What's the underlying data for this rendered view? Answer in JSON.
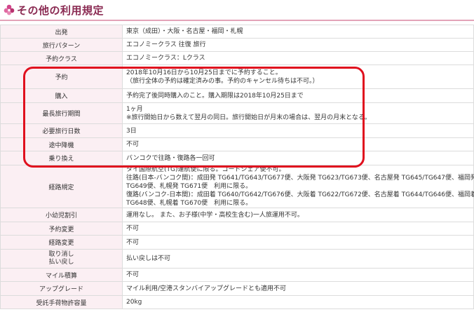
{
  "header": {
    "title": "その他の利用規定"
  },
  "rows": [
    {
      "label": "出発",
      "lines": [
        "東京（成田）・大阪・名古屋・福岡・札幌"
      ]
    },
    {
      "label": "旅行パターン",
      "lines": [
        "エコノミークラス 往復 旅行"
      ]
    },
    {
      "label": "予約クラス",
      "lines": [
        "エコノミークラス：Lクラス"
      ]
    },
    {
      "label": "予約",
      "lines": [
        "2018年10月16日から10月25日までに予約すること。",
        "（旅行全体の予約は確定済みの事。予約のキャンセル待ちは不可。）"
      ]
    },
    {
      "label": "購入",
      "lines": [
        "予約完了後同時購入のこと。購入期限は2018年10月25日まで"
      ]
    },
    {
      "label": "最長旅行期間",
      "lines": [
        "1ヶ月",
        "※旅行開始日から数えて翌月の同日。旅行開始日が月末の場合は、翌月の月末となる。"
      ]
    },
    {
      "label": "必要旅行日数",
      "lines": [
        "3日"
      ]
    },
    {
      "label": "途中降機",
      "lines": [
        "不可"
      ]
    },
    {
      "label": "乗り換え",
      "lines": [
        "バンコクで往路・復路各一回可"
      ]
    },
    {
      "label": "経路規定",
      "lines": [
        "タイ国際航空(TG)運航便に限る。コードシェア便不可。",
        "往路(日本-バンコク間)：成田発 TG641/TG643/TG677便、大阪発 TG623/TG673便、名古屋発 TG645/TG647便、福岡発",
        "TG649便、札幌発 TG671便　利用に限る。",
        "復路(バンコク-日本間)：成田着 TG640/TG642/TG676便、大阪着 TG622/TG672便、名古屋着 TG644/TG646便、福岡着",
        "TG648便、札幌着 TG670便　利用に限る。"
      ]
    },
    {
      "label": "小幼児割引",
      "lines": [
        "運用なし。 また、お子様(中学・高校生含む)一人旅運用不可。"
      ]
    },
    {
      "label": "予約変更",
      "lines": [
        "不可"
      ]
    },
    {
      "label": "経路変更",
      "lines": [
        "不可"
      ]
    },
    {
      "label": "取り消し\n払い戻し",
      "lines": [
        "払い戻しは不可"
      ]
    },
    {
      "label": "マイル積算",
      "lines": [
        "不可"
      ]
    },
    {
      "label": "アップグレード",
      "lines": [
        "マイル利用/空港スタンバイアップグレードとも適用不可"
      ]
    },
    {
      "label": "受託手荷物許容量",
      "lines": [
        "20kg"
      ]
    }
  ]
}
